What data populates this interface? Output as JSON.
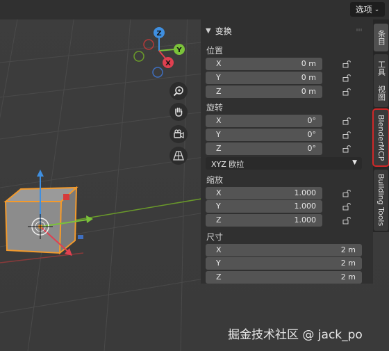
{
  "topbar": {
    "options_label": "选项"
  },
  "panel": {
    "header": "变换",
    "location": {
      "label": "位置",
      "fields": [
        {
          "axis": "X",
          "value": "0 m"
        },
        {
          "axis": "Y",
          "value": "0 m"
        },
        {
          "axis": "Z",
          "value": "0 m"
        }
      ]
    },
    "rotation": {
      "label": "旋转",
      "fields": [
        {
          "axis": "X",
          "value": "0°"
        },
        {
          "axis": "Y",
          "value": "0°"
        },
        {
          "axis": "Z",
          "value": "0°"
        }
      ]
    },
    "rotation_mode": "XYZ 欧拉",
    "scale": {
      "label": "缩放",
      "fields": [
        {
          "axis": "X",
          "value": "1.000"
        },
        {
          "axis": "Y",
          "value": "1.000"
        },
        {
          "axis": "Z",
          "value": "1.000"
        }
      ]
    },
    "dimensions": {
      "label": "尺寸",
      "fields": [
        {
          "axis": "X",
          "value": "2 m"
        },
        {
          "axis": "Y",
          "value": "2 m"
        },
        {
          "axis": "Z",
          "value": "2 m"
        }
      ]
    }
  },
  "tabs": [
    {
      "label": "条目"
    },
    {
      "label": "工具"
    },
    {
      "label": "视图"
    },
    {
      "label": "BlenderMCP"
    },
    {
      "label": "Building Tools"
    }
  ],
  "gizmo": {
    "x_label": "X",
    "y_label": "Y",
    "z_label": "Z"
  },
  "viewport_icons": [
    "zoom-icon",
    "hand-pan-icon",
    "camera-icon",
    "perspective-grid-icon"
  ],
  "watermark": "掘金技术社区 @ jack_po"
}
